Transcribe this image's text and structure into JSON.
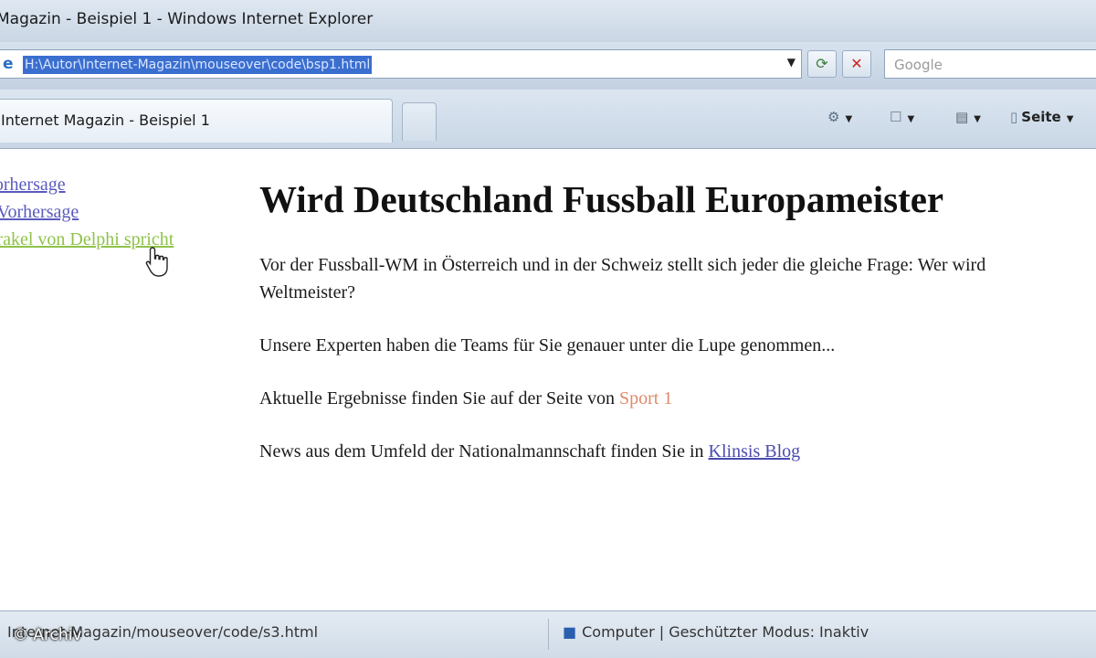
{
  "window": {
    "title": "Magazin - Beispiel 1 - Windows Internet Explorer"
  },
  "address_bar": {
    "url": "H:\\Autor\\Internet-Magazin\\mouseover\\code\\bsp1.html"
  },
  "search": {
    "placeholder": "Google"
  },
  "tab": {
    "title": "Internet Magazin - Beispiel 1"
  },
  "command_bar": {
    "page_label": "Seite"
  },
  "side_links": [
    {
      "label": "Vorhersage"
    },
    {
      "label": "n Vorhersage"
    },
    {
      "label": "Orakel von Delphi spricht"
    }
  ],
  "main": {
    "heading": "Wird Deutschland Fussball Europameister",
    "para1": "Vor der Fussball-WM in Österreich und in der Schweiz stellt sich jeder die gleiche Frage: Wer wird Weltmeister?",
    "para2": "Unsere Experten haben die Teams für Sie genauer unter die Lupe genommen...",
    "para3_text": "Aktuelle Ergebnisse finden Sie auf der Seite von",
    "para3_link": "Sport 1",
    "para4_text": "News aus dem Umfeld der Nationalmannschaft finden Sie in",
    "para4_link": "Klinsis Blog"
  },
  "status_bar": {
    "url": "Internet-Magazin/mouseover/code/s3.html",
    "zone": "Computer | Geschützter Modus: Inaktiv"
  },
  "overlay": {
    "copyright": "© Archiv"
  },
  "colors": {
    "link": "#5a5abf",
    "hover_link": "#8fc34a",
    "sport_link": "#e08a6a",
    "url_selection": "#3a6fd0"
  }
}
